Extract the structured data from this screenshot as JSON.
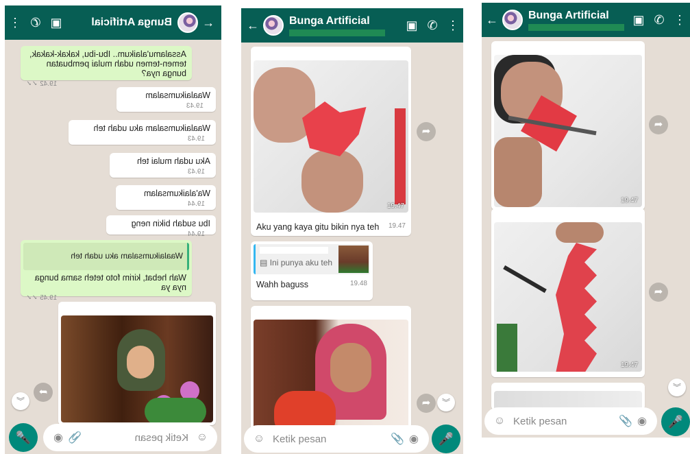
{
  "contact_name": "Bunga Artificial",
  "composer_placeholder": "Ketik pesan",
  "colors": {
    "header": "#075e54",
    "chat_bg": "#e5ddd5",
    "outgoing": "#dcf8c6",
    "incoming": "#ffffff",
    "mic": "#00897b"
  },
  "panel1": {
    "messages": [
      {
        "text": "Assalamu'alaikum.. Ibu-ibu, kakak-kakak, temen-temen udah mulai pembuatan bunga nya?",
        "time": "19.42"
      },
      {
        "text": "Waalaikumsalam",
        "time": "19.43"
      },
      {
        "text": "Waalaikumsalam aku udah teh",
        "time": "19.43"
      },
      {
        "text": "Aku udah mulai teh",
        "time": "19.43"
      },
      {
        "text": "Wa'alaikumsalam",
        "time": "19.44"
      },
      {
        "text": "Ibu sudah bikin neng",
        "time": "19.44"
      },
      {
        "quote": "Waalaikumsalam aku udah teh",
        "text": "Wah hebat, kirim foto teteh sama bunga nya ya",
        "time": "19.45"
      }
    ]
  },
  "panel2": {
    "photo_time": "19.47",
    "caption": {
      "text": "Aku yang kaya gitu bikin nya teh",
      "time": "19.47"
    },
    "reply_msg": {
      "quote": "Ini punya aku teh",
      "text": "Wahh baguss",
      "time": "19.48"
    }
  },
  "panel3": {
    "photo1_time": "19.47",
    "photo2_time": "19.47"
  },
  "icons": [
    "back-arrow-icon",
    "video-call-icon",
    "phone-icon",
    "menu-icon",
    "emoji-icon",
    "attach-icon",
    "camera-icon",
    "mic-icon",
    "forward-icon",
    "scroll-down-icon"
  ]
}
